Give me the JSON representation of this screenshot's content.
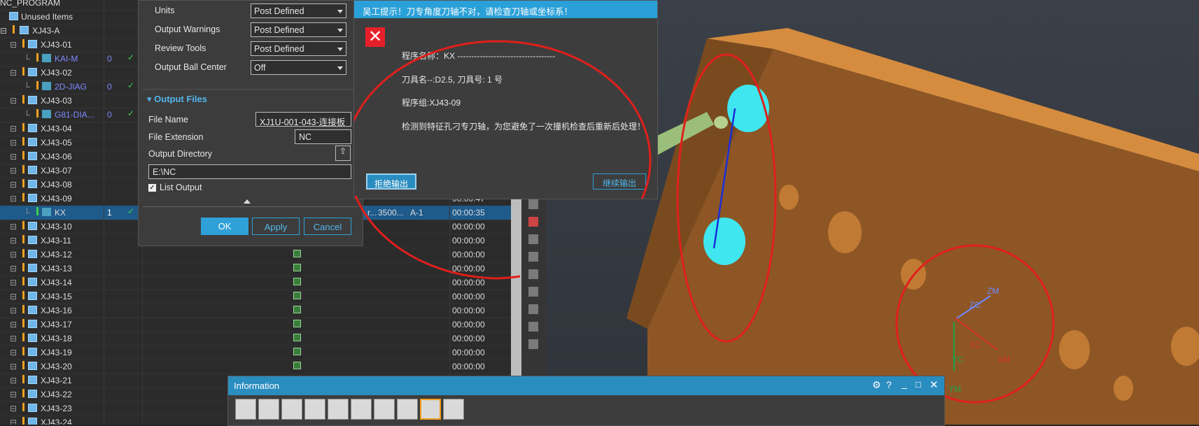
{
  "navigator": {
    "root": "NC_PROGRAM",
    "unused": "Unused Items",
    "group_a": "XJ43-A",
    "rows": [
      {
        "label": "XJ43-01",
        "level": 2,
        "type": "folder"
      },
      {
        "label": "KAI-M",
        "level": 3,
        "type": "op",
        "blue": true,
        "num": "0",
        "check": true
      },
      {
        "label": "XJ43-02",
        "level": 2,
        "type": "folder"
      },
      {
        "label": "2D-JIAG",
        "level": 3,
        "type": "op",
        "blue": true,
        "num": "0",
        "check": true
      },
      {
        "label": "XJ43-03",
        "level": 2,
        "type": "folder"
      },
      {
        "label": "G81-DIA...",
        "level": 3,
        "type": "op",
        "blue": true,
        "num": "0",
        "check": true
      },
      {
        "label": "XJ43-04",
        "level": 2,
        "type": "folder"
      },
      {
        "label": "XJ43-05",
        "level": 2,
        "type": "folder"
      },
      {
        "label": "XJ43-06",
        "level": 2,
        "type": "folder"
      },
      {
        "label": "XJ43-07",
        "level": 2,
        "type": "folder"
      },
      {
        "label": "XJ43-08",
        "level": 2,
        "type": "folder",
        "time": "00:00:..."
      },
      {
        "label": "XJ43-09",
        "level": 2,
        "type": "folder",
        "time": "00:00:47"
      },
      {
        "label": "KX",
        "level": 3,
        "type": "op",
        "num": "1",
        "check": true,
        "selected": true,
        "time": "00:00:35",
        "extra1": "r...",
        "extra2": "3500...",
        "extra3": "A-1"
      },
      {
        "label": "XJ43-10",
        "level": 2,
        "type": "folder",
        "time": "00:00:00"
      },
      {
        "label": "XJ43-11",
        "level": 2,
        "type": "folder",
        "time": "00:00:00"
      },
      {
        "label": "XJ43-12",
        "level": 2,
        "type": "folder",
        "time": "00:00:00"
      },
      {
        "label": "XJ43-13",
        "level": 2,
        "type": "folder",
        "time": "00:00:00"
      },
      {
        "label": "XJ43-14",
        "level": 2,
        "type": "folder",
        "time": "00:00:00"
      },
      {
        "label": "XJ43-15",
        "level": 2,
        "type": "folder",
        "time": "00:00:00"
      },
      {
        "label": "XJ43-16",
        "level": 2,
        "type": "folder",
        "time": "00:00:00"
      },
      {
        "label": "XJ43-17",
        "level": 2,
        "type": "folder",
        "time": "00:00:00"
      },
      {
        "label": "XJ43-18",
        "level": 2,
        "type": "folder",
        "time": "00:00:00"
      },
      {
        "label": "XJ43-19",
        "level": 2,
        "type": "folder",
        "time": "00:00:00"
      },
      {
        "label": "XJ43-20",
        "level": 2,
        "type": "folder",
        "time": "00:00:00"
      },
      {
        "label": "XJ43-21",
        "level": 2,
        "type": "folder"
      },
      {
        "label": "XJ43-22",
        "level": 2,
        "type": "folder"
      },
      {
        "label": "XJ43-23",
        "level": 2,
        "type": "folder"
      },
      {
        "label": "XJ43-24",
        "level": 2,
        "type": "folder"
      }
    ]
  },
  "postprocess": {
    "units_label": "Units",
    "units_value": "Post Defined",
    "warnings_label": "Output Warnings",
    "warnings_value": "Post Defined",
    "review_label": "Review Tools",
    "review_value": "Post Defined",
    "ball_label": "Output Ball Center",
    "ball_value": "Off",
    "section_title": "Output Files",
    "file_name_label": "File Name",
    "file_name_value": "XJ1U-001-043-连接板",
    "ext_label": "File Extension",
    "ext_value": "NC",
    "dir_label": "Output Directory",
    "dir_value": "E:\\NC",
    "list_output_label": "List Output",
    "ok": "OK",
    "apply": "Apply",
    "cancel": "Cancel"
  },
  "warning_dialog": {
    "title": "吴工提示！刀专角度刀轴不对，请检查刀轴或坐标系！",
    "line1": "程序名称：KX -----------------------------------",
    "line2": "刀具名--:D2.5,        刀具号:   1 号",
    "line3": "程序组:XJ43-09",
    "line4": "检测到特征孔刁专刀轴，为您避免了一次撞机检查后重新后处理！",
    "reject": "拒绝输出",
    "continue": "继续输出"
  },
  "info_window": {
    "title": "Information"
  },
  "axes": {
    "zc": "ZC",
    "zm": "ZM",
    "xc": "XC",
    "xm": "XM",
    "yc": "YC",
    "ym": "YM"
  },
  "colors": {
    "accent": "#2aa0d8",
    "annotation": "#e0201c",
    "part": "#a0612a",
    "hole_highlight": "#3fe6f0",
    "check": "#3bd14a"
  }
}
